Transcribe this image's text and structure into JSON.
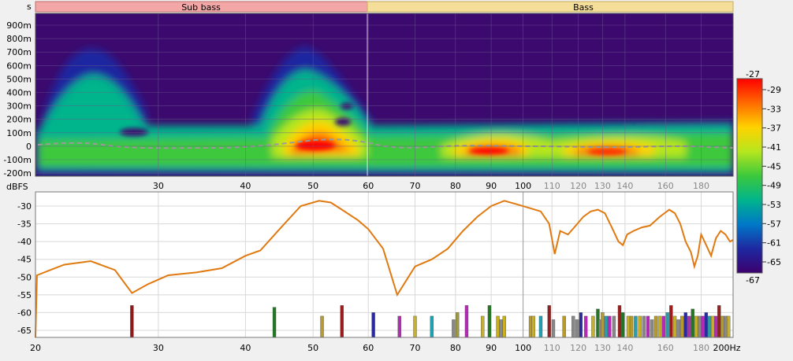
{
  "bands": [
    {
      "label": "Sub bass",
      "color": "#f2a6a6"
    },
    {
      "label": "Bass",
      "color": "#f5dd9a"
    }
  ],
  "spectrogram": {
    "unit_label": "s",
    "y_unit_label": "dBFS",
    "y_ticks": [
      "900m",
      "800m",
      "700m",
      "600m",
      "500m",
      "400m",
      "300m",
      "200m",
      "100m",
      "0",
      "-100m",
      "-200m"
    ],
    "x_ticks": [
      {
        "value": 30,
        "label": "30",
        "muted": false
      },
      {
        "value": 40,
        "label": "40",
        "muted": false
      },
      {
        "value": 50,
        "label": "50",
        "muted": false
      },
      {
        "value": 60,
        "label": "60",
        "muted": false
      },
      {
        "value": 70,
        "label": "70",
        "muted": false
      },
      {
        "value": 80,
        "label": "80",
        "muted": false
      },
      {
        "value": 90,
        "label": "90",
        "muted": false
      },
      {
        "value": 100,
        "label": "100",
        "muted": false
      },
      {
        "value": 110,
        "label": "110",
        "muted": true
      },
      {
        "value": 120,
        "label": "120",
        "muted": true
      },
      {
        "value": 130,
        "label": "130",
        "muted": true
      },
      {
        "value": 140,
        "label": "140",
        "muted": true
      },
      {
        "value": 160,
        "label": "160",
        "muted": true
      },
      {
        "value": 180,
        "label": "180",
        "muted": true
      }
    ],
    "colorbar": {
      "top_label": "-27",
      "bottom_label": "-67",
      "ticks": [
        "-29",
        "-33",
        "-37",
        "-41",
        "-45",
        "-49",
        "-53",
        "-57",
        "-61",
        "-65"
      ],
      "colors": [
        "#ff0000",
        "#ff6a00",
        "#ffd200",
        "#b6e61e",
        "#3cc83c",
        "#00b48c",
        "#0078c8",
        "#1e28a0",
        "#3c006e"
      ]
    }
  },
  "chart_data": {
    "type": "line",
    "xscale": "log",
    "xlim": [
      20,
      200
    ],
    "ylim": [
      -67,
      -26
    ],
    "x_ticks": [
      {
        "value": 20,
        "label": "20",
        "muted": false
      },
      {
        "value": 30,
        "label": "30",
        "muted": false
      },
      {
        "value": 40,
        "label": "40",
        "muted": false
      },
      {
        "value": 50,
        "label": "50",
        "muted": false
      },
      {
        "value": 60,
        "label": "60",
        "muted": false
      },
      {
        "value": 70,
        "label": "70",
        "muted": false
      },
      {
        "value": 80,
        "label": "80",
        "muted": false
      },
      {
        "value": 90,
        "label": "90",
        "muted": false
      },
      {
        "value": 100,
        "label": "100",
        "muted": false
      },
      {
        "value": 110,
        "label": "110",
        "muted": true
      },
      {
        "value": 120,
        "label": "120",
        "muted": true
      },
      {
        "value": 130,
        "label": "130",
        "muted": true
      },
      {
        "value": 140,
        "label": "140",
        "muted": true
      },
      {
        "value": 160,
        "label": "160",
        "muted": true
      },
      {
        "value": 180,
        "label": "180",
        "muted": true
      },
      {
        "value": 200,
        "label": "200Hz",
        "muted": false
      }
    ],
    "y_ticks": [
      -30,
      -35,
      -40,
      -45,
      -50,
      -55,
      -60,
      -65
    ],
    "line_color": "#e07a10",
    "series": [
      {
        "x": [
          20,
          20.1,
          21,
          22,
          24,
          26,
          27.5,
          29,
          31,
          34,
          37,
          40,
          42,
          45,
          48,
          51,
          53,
          55,
          58,
          60,
          63,
          66,
          70,
          74,
          78,
          82,
          86,
          90,
          94,
          98,
          102,
          106,
          109,
          111,
          113,
          116,
          119,
          122,
          125,
          128,
          131,
          134,
          137,
          139,
          141,
          144,
          148,
          152,
          157,
          162,
          165,
          168,
          171,
          174,
          176,
          178,
          180,
          183,
          186,
          189,
          192,
          195,
          198,
          200
        ],
        "y": [
          -67,
          -49.5,
          -48,
          -46.5,
          -45.5,
          -48,
          -54.5,
          -52,
          -49.5,
          -48.7,
          -47.5,
          -44,
          -42.5,
          -36,
          -30,
          -28.5,
          -29,
          -31,
          -34,
          -36.5,
          -42,
          -55,
          -47,
          -45,
          -42,
          -37,
          -33,
          -30,
          -28.5,
          -29.5,
          -30.5,
          -31.5,
          -35,
          -43.5,
          -37,
          -38,
          -35.5,
          -33,
          -31.5,
          -31,
          -32,
          -36,
          -40,
          -41,
          -38,
          -37,
          -36,
          -35.5,
          -33,
          -31,
          -32,
          -35,
          -40,
          -43,
          -47,
          -44,
          -38,
          -41,
          -44,
          -39,
          -37,
          -38,
          -40,
          -39.5
        ]
      }
    ],
    "markers": [
      {
        "x": 27.5,
        "value": -58,
        "color": "#8b1a1a"
      },
      {
        "x": 44,
        "value": -58.5,
        "color": "#1e7a1e"
      },
      {
        "x": 51.5,
        "value": -61,
        "color": "#b89a2a"
      },
      {
        "x": 55,
        "value": -58,
        "color": "#9b1c1c"
      },
      {
        "x": 61,
        "value": -60,
        "color": "#2a2aa0"
      },
      {
        "x": 66.5,
        "value": -61,
        "color": "#b52ab5"
      },
      {
        "x": 70,
        "value": -61,
        "color": "#c8b020"
      },
      {
        "x": 74,
        "value": -61,
        "color": "#20a0b0"
      },
      {
        "x": 79.5,
        "value": -62,
        "color": "#888888"
      },
      {
        "x": 80.5,
        "value": -60,
        "color": "#a09a30"
      },
      {
        "x": 83,
        "value": -58,
        "color": "#b52ab5"
      },
      {
        "x": 87.5,
        "value": -61,
        "color": "#c8b020"
      },
      {
        "x": 89.5,
        "value": -58,
        "color": "#1e7a1e"
      },
      {
        "x": 92,
        "value": -61,
        "color": "#c8b020"
      },
      {
        "x": 93,
        "value": -62,
        "color": "#888888"
      },
      {
        "x": 94,
        "value": -61,
        "color": "#c8b020"
      },
      {
        "x": 102.5,
        "value": -61,
        "color": "#b89a2a"
      },
      {
        "x": 103.5,
        "value": -61,
        "color": "#c8b020"
      },
      {
        "x": 106,
        "value": -61,
        "color": "#20a0b0"
      },
      {
        "x": 109,
        "value": -58,
        "color": "#9b1c1c"
      },
      {
        "x": 110.5,
        "value": -62,
        "color": "#888888"
      },
      {
        "x": 114.5,
        "value": -61,
        "color": "#b89a2a"
      },
      {
        "x": 118,
        "value": -61,
        "color": "#888888"
      },
      {
        "x": 119.5,
        "value": -62,
        "color": "#888888"
      },
      {
        "x": 121,
        "value": -60,
        "color": "#2a2aa0"
      },
      {
        "x": 123,
        "value": -61,
        "color": "#b52ab5"
      },
      {
        "x": 126,
        "value": -61,
        "color": "#c8b020"
      },
      {
        "x": 128,
        "value": -59,
        "color": "#1e7a1e"
      },
      {
        "x": 129,
        "value": -62,
        "color": "#888888"
      },
      {
        "x": 130,
        "value": -60,
        "color": "#b89a2a"
      },
      {
        "x": 131.5,
        "value": -61,
        "color": "#20a0b0"
      },
      {
        "x": 133,
        "value": -61,
        "color": "#b52ab5"
      },
      {
        "x": 135,
        "value": -61,
        "color": "#888888"
      },
      {
        "x": 137.5,
        "value": -58,
        "color": "#9b1c1c"
      },
      {
        "x": 139,
        "value": -60,
        "color": "#1e7a1e"
      },
      {
        "x": 141.5,
        "value": -61,
        "color": "#c8b020"
      },
      {
        "x": 143,
        "value": -61,
        "color": "#b89a2a"
      },
      {
        "x": 145,
        "value": -61,
        "color": "#20a0b0"
      },
      {
        "x": 147,
        "value": -61,
        "color": "#c8b020"
      },
      {
        "x": 149,
        "value": -61,
        "color": "#888888"
      },
      {
        "x": 151,
        "value": -61,
        "color": "#b52ab5"
      },
      {
        "x": 153,
        "value": -62,
        "color": "#888888"
      },
      {
        "x": 155,
        "value": -61,
        "color": "#b89a2a"
      },
      {
        "x": 157,
        "value": -61,
        "color": "#c8b020"
      },
      {
        "x": 159,
        "value": -61,
        "color": "#b52ab5"
      },
      {
        "x": 161,
        "value": -60,
        "color": "#20a0b0"
      },
      {
        "x": 163,
        "value": -58,
        "color": "#9b1c1c"
      },
      {
        "x": 165,
        "value": -61,
        "color": "#c8b020"
      },
      {
        "x": 167,
        "value": -62,
        "color": "#888888"
      },
      {
        "x": 169,
        "value": -61,
        "color": "#b89a2a"
      },
      {
        "x": 171,
        "value": -60,
        "color": "#2a2aa0"
      },
      {
        "x": 173,
        "value": -61,
        "color": "#b52ab5"
      },
      {
        "x": 175,
        "value": -59,
        "color": "#1e7a1e"
      },
      {
        "x": 177,
        "value": -61,
        "color": "#c8b020"
      },
      {
        "x": 179,
        "value": -61,
        "color": "#888888"
      },
      {
        "x": 181,
        "value": -61,
        "color": "#b52ab5"
      },
      {
        "x": 183,
        "value": -60,
        "color": "#2a2aa0"
      },
      {
        "x": 185,
        "value": -61,
        "color": "#20a0b0"
      },
      {
        "x": 187,
        "value": -61,
        "color": "#c8b020"
      },
      {
        "x": 189,
        "value": -61,
        "color": "#b52ab5"
      },
      {
        "x": 191,
        "value": -58,
        "color": "#9b1c1c"
      },
      {
        "x": 193,
        "value": -61,
        "color": "#b89a2a"
      },
      {
        "x": 195,
        "value": -61,
        "color": "#888888"
      },
      {
        "x": 197,
        "value": -61,
        "color": "#c8b020"
      }
    ]
  }
}
